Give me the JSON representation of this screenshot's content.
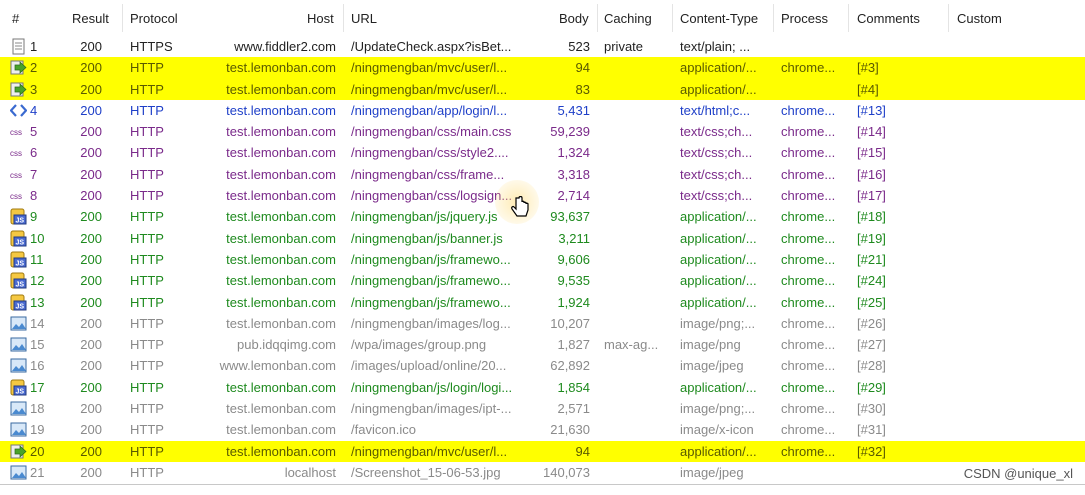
{
  "headers": {
    "num": "#",
    "result": "Result",
    "protocol": "Protocol",
    "host": "Host",
    "url": "URL",
    "body": "Body",
    "caching": "Caching",
    "content_type": "Content-Type",
    "process": "Process",
    "comments": "Comments",
    "custom": "Custom"
  },
  "colors": {
    "highlight": "#ffff00",
    "green": "#1e8a1e",
    "blue": "#1e3fc8",
    "purple": "#7a2a8a",
    "gray": "#8a8a8a"
  },
  "rows": [
    {
      "num": "1",
      "result": "200",
      "protocol": "HTTPS",
      "host": "www.fiddler2.com",
      "url": "/UpdateCheck.aspx?isBet...",
      "body": "523",
      "caching": "private",
      "content_type": "text/plain; ...",
      "process": "",
      "comments": "",
      "icon": "document-icon",
      "style": "plain"
    },
    {
      "num": "2",
      "result": "200",
      "protocol": "HTTP",
      "host": "test.lemonban.com",
      "url": "/ningmengban/mvc/user/l...",
      "body": "94",
      "caching": "",
      "content_type": "application/...",
      "process": "chrome...",
      "comments": "[#3]",
      "icon": "arrow-right-icon",
      "style": "selected"
    },
    {
      "num": "3",
      "result": "200",
      "protocol": "HTTP",
      "host": "test.lemonban.com",
      "url": "/ningmengban/mvc/user/l...",
      "body": "83",
      "caching": "",
      "content_type": "application/...",
      "process": "",
      "comments": "[#4]",
      "icon": "arrow-right-icon",
      "style": "selected"
    },
    {
      "num": "4",
      "result": "200",
      "protocol": "HTTP",
      "host": "test.lemonban.com",
      "url": "/ningmengban/app/login/l...",
      "body": "5,431",
      "caching": "",
      "content_type": "text/html;c...",
      "process": "chrome...",
      "comments": "[#13]",
      "icon": "html-icon",
      "style": "blue"
    },
    {
      "num": "5",
      "result": "200",
      "protocol": "HTTP",
      "host": "test.lemonban.com",
      "url": "/ningmengban/css/main.css",
      "body": "59,239",
      "caching": "",
      "content_type": "text/css;ch...",
      "process": "chrome...",
      "comments": "[#14]",
      "icon": "css-icon",
      "style": "purple"
    },
    {
      "num": "6",
      "result": "200",
      "protocol": "HTTP",
      "host": "test.lemonban.com",
      "url": "/ningmengban/css/style2....",
      "body": "1,324",
      "caching": "",
      "content_type": "text/css;ch...",
      "process": "chrome...",
      "comments": "[#15]",
      "icon": "css-icon",
      "style": "purple"
    },
    {
      "num": "7",
      "result": "200",
      "protocol": "HTTP",
      "host": "test.lemonban.com",
      "url": "/ningmengban/css/frame...",
      "body": "3,318",
      "caching": "",
      "content_type": "text/css;ch...",
      "process": "chrome...",
      "comments": "[#16]",
      "icon": "css-icon",
      "style": "purple"
    },
    {
      "num": "8",
      "result": "200",
      "protocol": "HTTP",
      "host": "test.lemonban.com",
      "url": "/ningmengban/css/logsign...",
      "body": "2,714",
      "caching": "",
      "content_type": "text/css;ch...",
      "process": "chrome...",
      "comments": "[#17]",
      "icon": "css-icon",
      "style": "purple"
    },
    {
      "num": "9",
      "result": "200",
      "protocol": "HTTP",
      "host": "test.lemonban.com",
      "url": "/ningmengban/js/jquery.js",
      "body": "93,637",
      "caching": "",
      "content_type": "application/...",
      "process": "chrome...",
      "comments": "[#18]",
      "icon": "js-icon",
      "style": "green"
    },
    {
      "num": "10",
      "result": "200",
      "protocol": "HTTP",
      "host": "test.lemonban.com",
      "url": "/ningmengban/js/banner.js",
      "body": "3,211",
      "caching": "",
      "content_type": "application/...",
      "process": "chrome...",
      "comments": "[#19]",
      "icon": "js-icon",
      "style": "green"
    },
    {
      "num": "11",
      "result": "200",
      "protocol": "HTTP",
      "host": "test.lemonban.com",
      "url": "/ningmengban/js/framewo...",
      "body": "9,606",
      "caching": "",
      "content_type": "application/...",
      "process": "chrome...",
      "comments": "[#21]",
      "icon": "js-icon",
      "style": "green"
    },
    {
      "num": "12",
      "result": "200",
      "protocol": "HTTP",
      "host": "test.lemonban.com",
      "url": "/ningmengban/js/framewo...",
      "body": "9,535",
      "caching": "",
      "content_type": "application/...",
      "process": "chrome...",
      "comments": "[#24]",
      "icon": "js-icon",
      "style": "green"
    },
    {
      "num": "13",
      "result": "200",
      "protocol": "HTTP",
      "host": "test.lemonban.com",
      "url": "/ningmengban/js/framewo...",
      "body": "1,924",
      "caching": "",
      "content_type": "application/...",
      "process": "chrome...",
      "comments": "[#25]",
      "icon": "js-icon",
      "style": "green"
    },
    {
      "num": "14",
      "result": "200",
      "protocol": "HTTP",
      "host": "test.lemonban.com",
      "url": "/ningmengban/images/log...",
      "body": "10,207",
      "caching": "",
      "content_type": "image/png;...",
      "process": "chrome...",
      "comments": "[#26]",
      "icon": "image-icon",
      "style": "gray"
    },
    {
      "num": "15",
      "result": "200",
      "protocol": "HTTP",
      "host": "pub.idqqimg.com",
      "url": "/wpa/images/group.png",
      "body": "1,827",
      "caching": "max-ag...",
      "content_type": "image/png",
      "process": "chrome...",
      "comments": "[#27]",
      "icon": "image-icon",
      "style": "gray"
    },
    {
      "num": "16",
      "result": "200",
      "protocol": "HTTP",
      "host": "www.lemonban.com",
      "url": "/images/upload/online/20...",
      "body": "62,892",
      "caching": "",
      "content_type": "image/jpeg",
      "process": "chrome...",
      "comments": "[#28]",
      "icon": "image-icon",
      "style": "gray"
    },
    {
      "num": "17",
      "result": "200",
      "protocol": "HTTP",
      "host": "test.lemonban.com",
      "url": "/ningmengban/js/login/logi...",
      "body": "1,854",
      "caching": "",
      "content_type": "application/...",
      "process": "chrome...",
      "comments": "[#29]",
      "icon": "js-icon",
      "style": "green"
    },
    {
      "num": "18",
      "result": "200",
      "protocol": "HTTP",
      "host": "test.lemonban.com",
      "url": "/ningmengban/images/ipt-...",
      "body": "2,571",
      "caching": "",
      "content_type": "image/png;...",
      "process": "chrome...",
      "comments": "[#30]",
      "icon": "image-icon",
      "style": "gray"
    },
    {
      "num": "19",
      "result": "200",
      "protocol": "HTTP",
      "host": "test.lemonban.com",
      "url": "/favicon.ico",
      "body": "21,630",
      "caching": "",
      "content_type": "image/x-icon",
      "process": "chrome...",
      "comments": "[#31]",
      "icon": "image-icon",
      "style": "gray"
    },
    {
      "num": "20",
      "result": "200",
      "protocol": "HTTP",
      "host": "test.lemonban.com",
      "url": "/ningmengban/mvc/user/l...",
      "body": "94",
      "caching": "",
      "content_type": "application/...",
      "process": "chrome...",
      "comments": "[#32]",
      "icon": "arrow-right-icon",
      "style": "selected"
    },
    {
      "num": "21",
      "result": "200",
      "protocol": "HTTP",
      "host": "localhost",
      "url": "/Screenshot_15-06-53.jpg",
      "body": "140,073",
      "caching": "",
      "content_type": "image/jpeg",
      "process": "",
      "comments": "",
      "icon": "image-icon",
      "style": "gray"
    }
  ],
  "watermark": "CSDN @unique_xl"
}
